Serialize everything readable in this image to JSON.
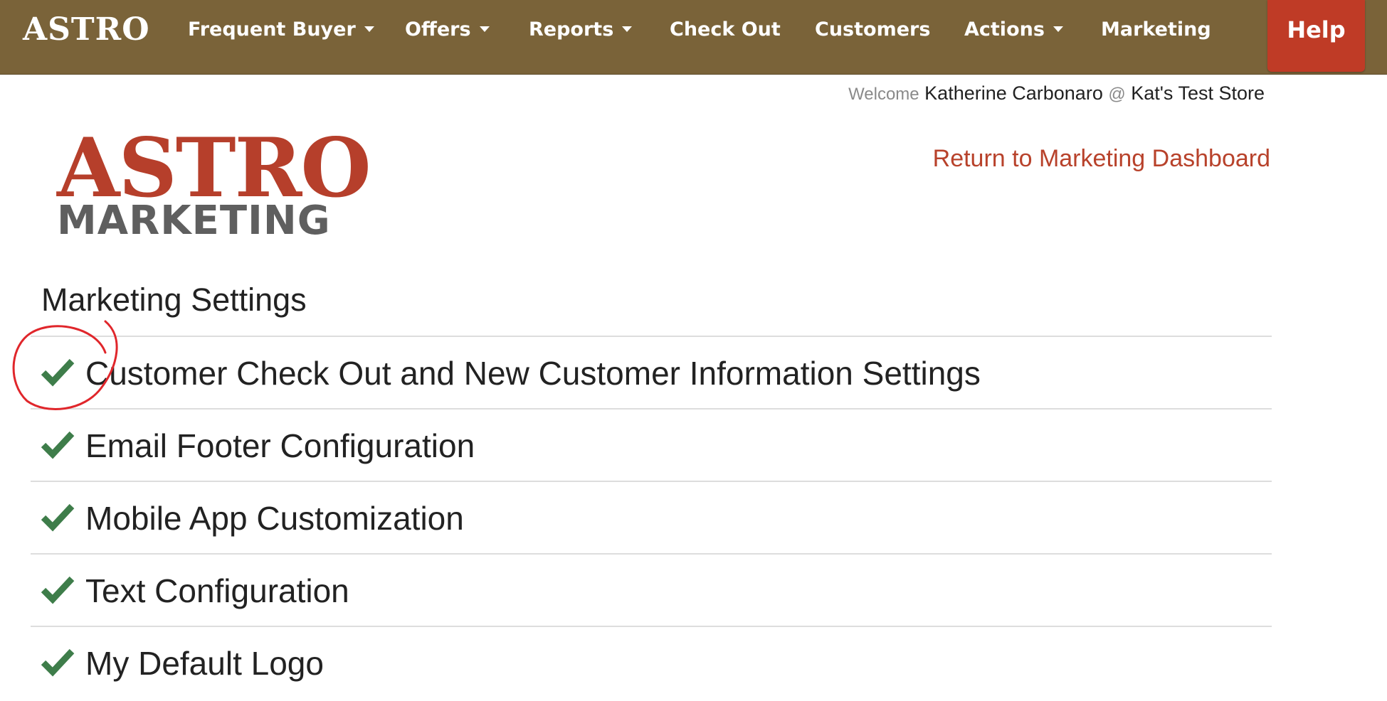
{
  "navbar": {
    "brand": "ASTRO",
    "items": [
      {
        "label": "Frequent Buyer",
        "dropdown": true
      },
      {
        "label": "Offers",
        "dropdown": true
      },
      {
        "label": "Reports",
        "dropdown": true
      },
      {
        "label": "Check Out",
        "dropdown": false
      },
      {
        "label": "Customers",
        "dropdown": false
      },
      {
        "label": "Actions",
        "dropdown": true
      },
      {
        "label": "Marketing",
        "dropdown": false
      }
    ],
    "help_label": "Help",
    "colors": {
      "bar": "#7a6339",
      "help": "#bf3b26"
    }
  },
  "welcome": {
    "prefix": "Welcome",
    "user": "Katherine Carbonaro",
    "at": "@",
    "store": "Kat's Test Store"
  },
  "logo": {
    "top": "ASTRO",
    "bottom": "MARKETING",
    "colors": {
      "top": "#b63f2b",
      "bottom": "#5f5f5f"
    }
  },
  "return_link": "Return to Marketing Dashboard",
  "section_title": "Marketing Settings",
  "settings": [
    {
      "label": "Customer Check Out and New Customer Information Settings",
      "icon": "check-icon"
    },
    {
      "label": "Email Footer Configuration",
      "icon": "check-icon"
    },
    {
      "label": "Mobile App Customization",
      "icon": "check-icon"
    },
    {
      "label": "Text Configuration",
      "icon": "check-icon"
    },
    {
      "label": "My Default Logo",
      "icon": "check-icon"
    }
  ],
  "colors": {
    "check": "#3e7d4a",
    "link": "#b8422b",
    "annotation": "#e0262b"
  }
}
